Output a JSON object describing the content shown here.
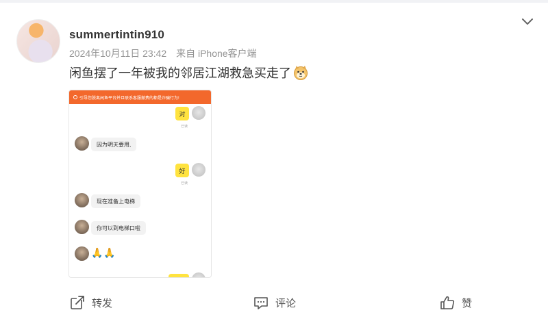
{
  "post": {
    "username": "summertintin910",
    "timestamp": "2024年10月11日 23:42",
    "source": "来自 iPhone客户端",
    "text": "闲鱼摆了一年被我的邻居江湖救急买走了",
    "emoji": "doge-icon"
  },
  "chat_image": {
    "banner": "引导您脱离闲鱼平台并且联系客服撤费的都是诈骗行为!",
    "messages": [
      {
        "side": "right",
        "text": "对",
        "status": "已读"
      },
      {
        "side": "left",
        "text": "因为明天要用,"
      },
      {
        "side": "right",
        "text": "好",
        "status": "已读"
      },
      {
        "side": "left",
        "text": "现在准备上电梯"
      },
      {
        "side": "left",
        "text": "你可以到电梯口啦"
      },
      {
        "side": "left",
        "text": "🙏🙏"
      }
    ]
  },
  "actions": {
    "repost": "转发",
    "comment": "评论",
    "like": "赞"
  },
  "colors": {
    "banner": "#f3682c",
    "bubble_right": "#ffe33f",
    "meta": "#939393"
  }
}
